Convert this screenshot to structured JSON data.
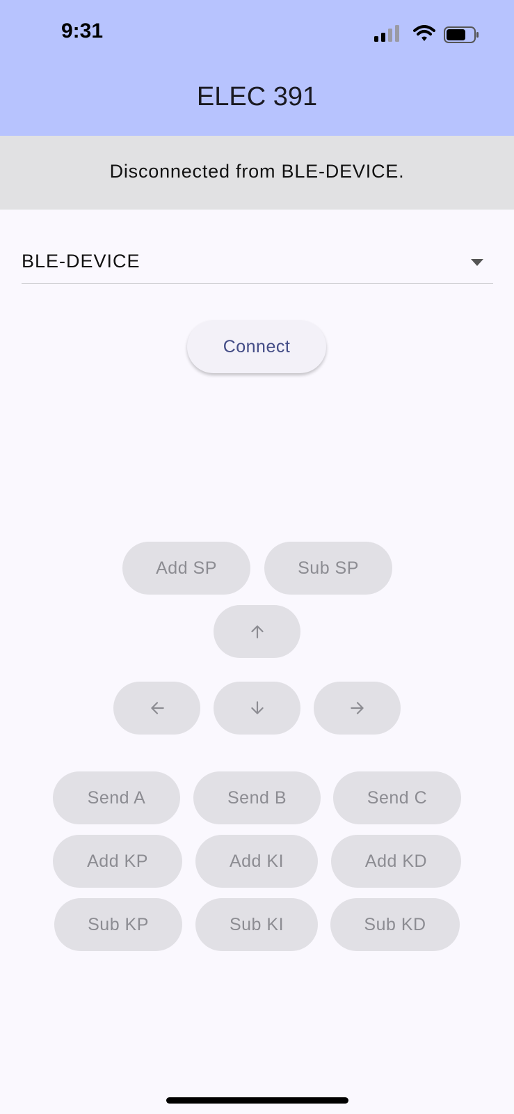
{
  "status_bar": {
    "time": "9:31"
  },
  "app_bar": {
    "title": "ELEC 391"
  },
  "banner": {
    "message": "Disconnected from BLE-DEVICE."
  },
  "device_select": {
    "value": "BLE-DEVICE"
  },
  "connect": {
    "label": "Connect"
  },
  "setpoint": {
    "add_label": "Add SP",
    "sub_label": "Sub SP"
  },
  "arrows": {
    "up_icon": "arrow-up-icon",
    "left_icon": "arrow-left-icon",
    "down_icon": "arrow-down-icon",
    "right_icon": "arrow-right-icon"
  },
  "send": {
    "a_label": "Send A",
    "b_label": "Send B",
    "c_label": "Send C"
  },
  "gains_add": {
    "kp_label": "Add KP",
    "ki_label": "Add KI",
    "kd_label": "Add KD"
  },
  "gains_sub": {
    "kp_label": "Sub KP",
    "ki_label": "Sub KI",
    "kd_label": "Sub KD"
  },
  "colors": {
    "app_bar": "#b7c3fe",
    "banner": "#e1e1e3",
    "background": "#faf8fe",
    "disabled_button": "#e1e0e5",
    "disabled_text": "#8c8c92",
    "connect_text": "#434c86"
  }
}
